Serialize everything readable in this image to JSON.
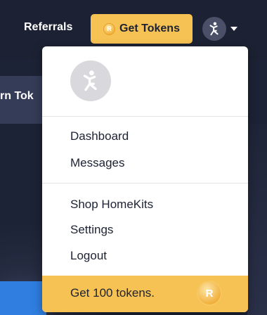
{
  "header": {
    "referrals_label": "Referrals",
    "get_tokens_label": "Get Tokens",
    "coin_glyph": "R",
    "accent_color": "#f6c253"
  },
  "background": {
    "partial_tab_label": "rn Tok"
  },
  "dropdown": {
    "items_group1": [
      "Dashboard",
      "Messages"
    ],
    "items_group2": [
      "Shop HomeKits",
      "Settings",
      "Logout"
    ],
    "footer_label": "Get 100 tokens.",
    "footer_coin_glyph": "R"
  },
  "icons": {
    "avatar": "person-icon",
    "caret": "chevron-down-icon",
    "coin": "token-coin-icon"
  }
}
